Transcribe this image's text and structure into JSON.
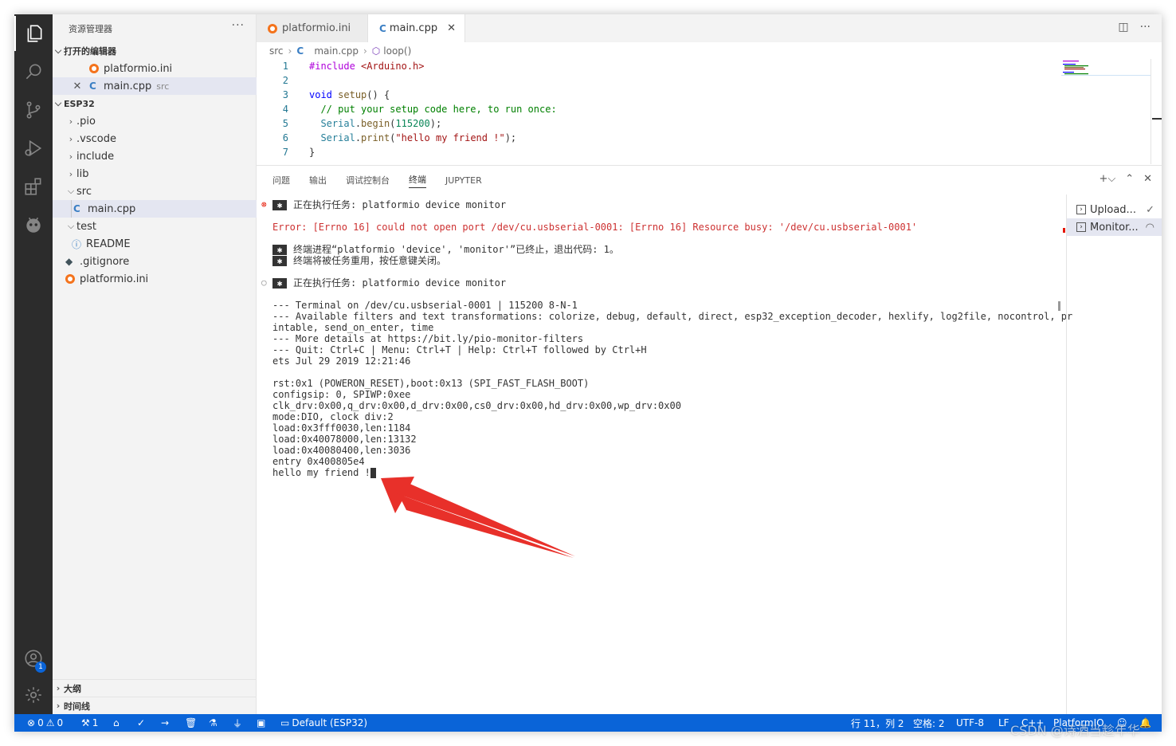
{
  "sidebar": {
    "title": "资源管理器",
    "more": "···",
    "open_editors_label": "打开的编辑器",
    "open_editors": [
      {
        "name": "platformio.ini",
        "suffix": ""
      },
      {
        "name": "main.cpp",
        "suffix": "src"
      }
    ],
    "workspace_label": "ESP32",
    "tree": [
      ".pio",
      ".vscode",
      "include",
      "lib",
      "src",
      "main.cpp",
      "test",
      "README",
      ".gitignore",
      "platformio.ini"
    ],
    "outline_label": "大纲",
    "timeline_label": "时间线"
  },
  "tabs": [
    {
      "label": "platformio.ini"
    },
    {
      "label": "main.cpp",
      "close": "✕"
    }
  ],
  "breadcrumb": {
    "folder": "src",
    "file": "main.cpp",
    "symbol": "loop()"
  },
  "code": {
    "line_numbers": [
      "1",
      "2",
      "3",
      "4",
      "5",
      "6",
      "7"
    ],
    "l1_directive": "#include",
    "l1_header": "<Arduino.h>",
    "l3_kw": "void",
    "l3_fn": "setup",
    "l3_rest": "() {",
    "l4_comment": "// put your setup code here, to run once:",
    "l5_obj": "Serial",
    "l5_fn": "begin",
    "l5_num": "115200",
    "l6_obj": "Serial",
    "l6_fn": "print",
    "l6_str": "\"hello my friend !\"",
    "l7": "}"
  },
  "panel": {
    "tabs": [
      "问题",
      "输出",
      "调试控制台",
      "终端",
      "JUPYTER"
    ],
    "active_tab": "终端"
  },
  "terminal": {
    "task1": "正在执行任务: platformio device monitor",
    "error": "Error: [Errno 16] could not open port /dev/cu.usbserial-0001: [Errno 16] Resource busy: '/dev/cu.usbserial-0001'",
    "ended1": "终端进程“platformio 'device', 'monitor'”已终止，退出代码: 1。",
    "ended2": "终端将被任务重用，按任意键关闭。",
    "task2": "正在执行任务: platformio device monitor",
    "lines": [
      "--- Terminal on /dev/cu.usbserial-0001 | 115200 8-N-1",
      "--- Available filters and text transformations: colorize, debug, default, direct, esp32_exception_decoder, hexlify, log2file, nocontrol, pr",
      "intable, send_on_enter, time",
      "--- More details at https://bit.ly/pio-monitor-filters",
      "--- Quit: Ctrl+C | Menu: Ctrl+T | Help: Ctrl+T followed by Ctrl+H",
      "ets Jul 29 2019 12:21:46",
      "",
      "rst:0x1 (POWERON_RESET),boot:0x13 (SPI_FAST_FLASH_BOOT)",
      "configsip: 0, SPIWP:0xee",
      "clk_drv:0x00,q_drv:0x00,d_drv:0x00,cs0_drv:0x00,hd_drv:0x00,wp_drv:0x00",
      "mode:DIO, clock div:2",
      "load:0x3fff0030,len:1184",
      "load:0x40078000,len:13132",
      "load:0x40080400,len:3036",
      "entry 0x400805e4",
      "hello my friend !"
    ],
    "instances": [
      {
        "label": "Upload...",
        "status": "✓"
      },
      {
        "label": "Monitor...",
        "status": "◠"
      }
    ]
  },
  "statusbar": {
    "errors": "0",
    "warnings": "0",
    "ports": "1",
    "env": "Default (ESP32)",
    "position": "行 11，列 2",
    "spaces": "空格: 2",
    "encoding": "UTF-8",
    "eol": "LF",
    "lang": "C++",
    "platformio": "PlatformIO"
  },
  "watermark": "CSDN @诗酒当趁年华",
  "colors": {
    "accent": "#0a64d8",
    "error": "#cd3131",
    "annotation_arrow": "#e8302a"
  }
}
